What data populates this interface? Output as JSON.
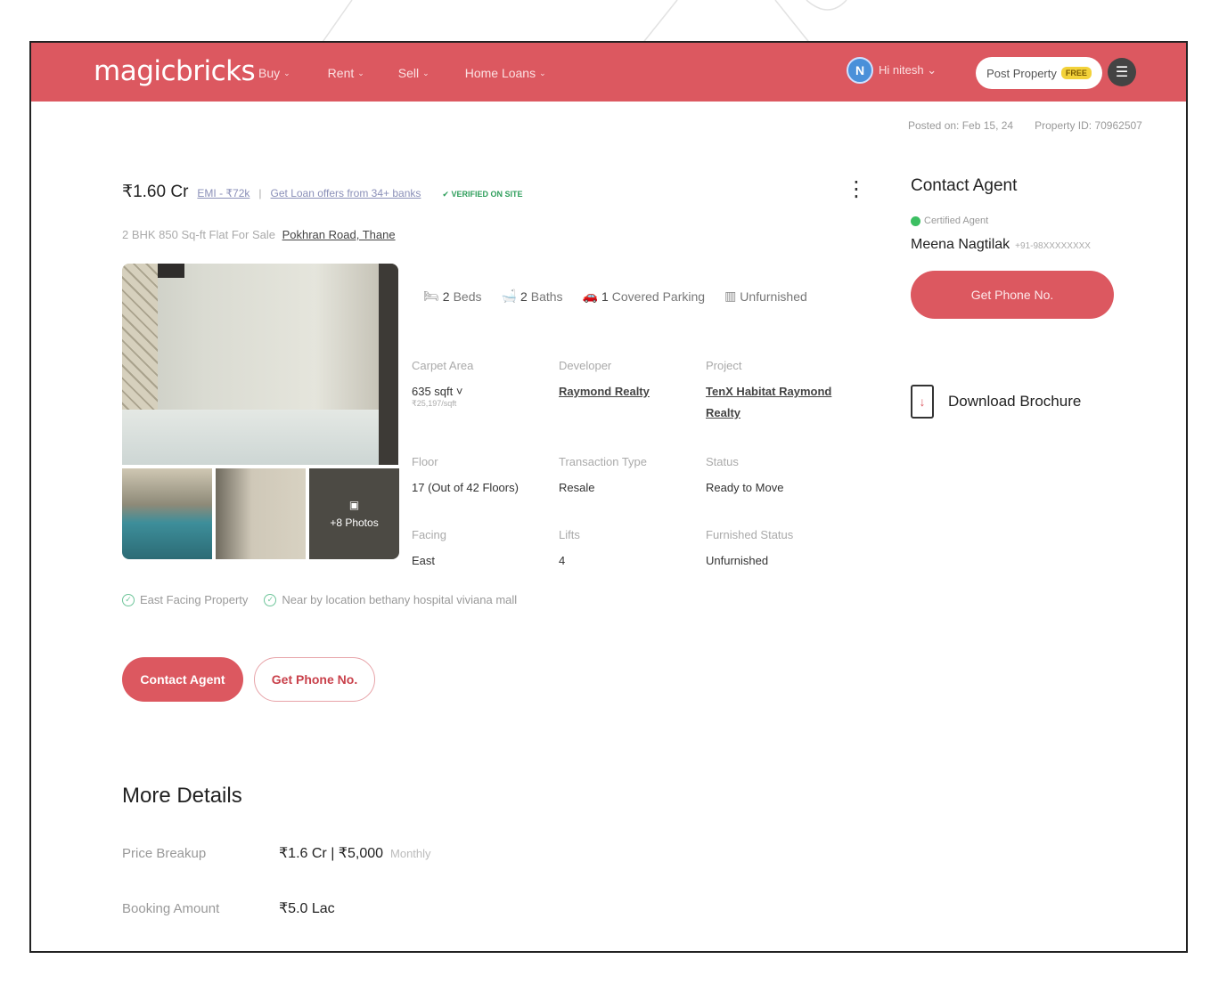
{
  "header": {
    "logo": "magicbricks",
    "nav": [
      {
        "label": "Buy"
      },
      {
        "label": "Rent"
      },
      {
        "label": "Sell"
      },
      {
        "label": "Home Loans"
      }
    ],
    "user_initial": "N",
    "user_name": "Hi nitesh",
    "post_property": "Post Property",
    "free_badge": "FREE"
  },
  "posted": {
    "posted_on": "Posted on: Feb 15, 24",
    "property_id": "Property ID: 70962507"
  },
  "listing": {
    "price": "₹1.60 Cr",
    "emi": "EMI - ₹72k",
    "separator": "|",
    "loan_offers": "Get Loan offers from 34+ banks",
    "verified": "✔ VERIFIED ON SITE",
    "subtitle": "2 BHK 850 Sq-ft Flat For Sale",
    "location": "Pokhran Road, Thane",
    "more_photos": "+8 Photos"
  },
  "features": [
    {
      "icon": "bed-icon",
      "glyph": "🛏",
      "strong": "2",
      "label": "Beds"
    },
    {
      "icon": "bath-icon",
      "glyph": "🛁",
      "strong": "2",
      "label": "Baths"
    },
    {
      "icon": "parking-icon",
      "glyph": "🚗",
      "strong": "1",
      "label": "Covered Parking"
    },
    {
      "icon": "furnish-icon",
      "glyph": "▥",
      "strong": "",
      "label": "Unfurnished"
    }
  ],
  "details": [
    {
      "label": "Carpet Area",
      "value": "635 sqft ˅",
      "sub": "₹25,197/sqft",
      "link": false
    },
    {
      "label": "Developer",
      "value": "Raymond Realty",
      "link": true
    },
    {
      "label": "Project",
      "value": "TenX Habitat Raymond Realty",
      "link": true
    },
    {
      "label": "Floor",
      "value": "17 (Out of 42 Floors)",
      "link": false
    },
    {
      "label": "Transaction Type",
      "value": "Resale",
      "link": false
    },
    {
      "label": "Status",
      "value": "Ready to Move",
      "link": false
    },
    {
      "label": "Facing",
      "value": "East",
      "link": false
    },
    {
      "label": "Lifts",
      "value": "4",
      "link": false
    },
    {
      "label": "Furnished Status",
      "value": "Unfurnished",
      "link": false
    }
  ],
  "tags": [
    "East Facing Property",
    "Near by location bethany hospital viviana mall"
  ],
  "actions": {
    "contact_agent": "Contact Agent",
    "get_phone": "Get Phone No."
  },
  "more_details": {
    "title": "More Details",
    "rows": [
      {
        "key": "Price Breakup",
        "value": "₹1.6 Cr | ₹5,000",
        "extra": "Monthly"
      },
      {
        "key": "Booking Amount",
        "value": "₹5.0 Lac",
        "extra": ""
      }
    ]
  },
  "agent_panel": {
    "title": "Contact Agent",
    "certified": "Certified Agent",
    "name": "Meena Nagtilak",
    "phone": "+91-98XXXXXXXX",
    "get_phone": "Get Phone No.",
    "download": "Download Brochure"
  },
  "colors": {
    "brand": "#dc5860",
    "verified": "#2e9e5b"
  }
}
